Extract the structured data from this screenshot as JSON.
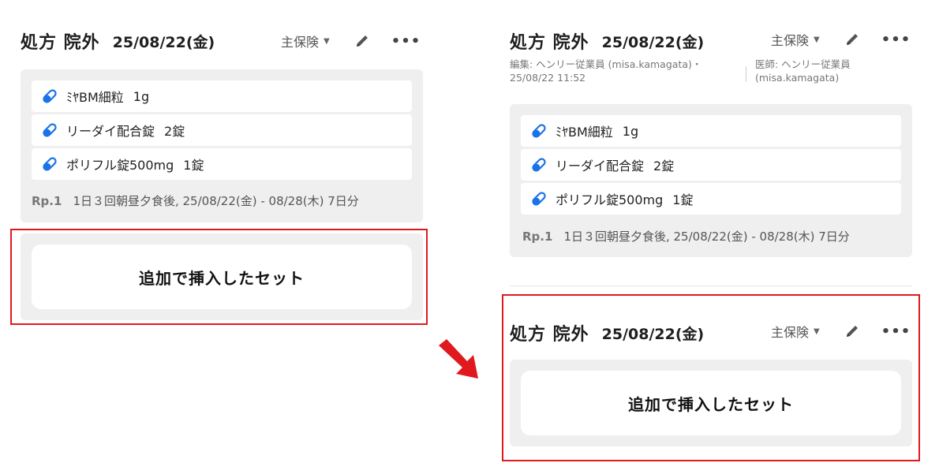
{
  "left_panel": {
    "title": "処方 院外",
    "date": "25/08/22(金)",
    "insurance": "主保険",
    "meds": [
      {
        "name": "ﾐﾔBM細粒",
        "qty": "1g"
      },
      {
        "name": "リーダイ配合錠",
        "qty": "2錠"
      },
      {
        "name": "ポリフル錠500mg",
        "qty": "1錠"
      }
    ],
    "rp_label": "Rp.1",
    "rp_text": "1日３回朝昼夕食後, 25/08/22(金) - 08/28(木) 7日分",
    "set_label": "追加で挿入したセット"
  },
  "right_panel": {
    "top_header": {
      "title": "処方 院外",
      "date": "25/08/22(金)",
      "insurance": "主保険"
    },
    "meta_editor": "編集: ヘンリー従業員 (misa.kamagata)・",
    "meta_time": "25/08/22 11:52",
    "meta_doctor": "医師: ヘンリー従業員",
    "meta_doctor_id": "(misa.kamagata)",
    "meds": [
      {
        "name": "ﾐﾔBM細粒",
        "qty": "1g"
      },
      {
        "name": "リーダイ配合錠",
        "qty": "2錠"
      },
      {
        "name": "ポリフル錠500mg",
        "qty": "1錠"
      }
    ],
    "rp_label": "Rp.1",
    "rp_text": "1日３回朝昼夕食後, 25/08/22(金) - 08/28(木) 7日分",
    "second_header": {
      "title": "処方 院外",
      "date": "25/08/22(金)",
      "insurance": "主保険"
    },
    "set_label": "追加で挿入したセット"
  },
  "icons": {
    "pill": "pill-icon",
    "pencil": "pencil-icon",
    "more": "more-icon",
    "caret": "chevron-down-icon",
    "arrow": "arrow-icon"
  },
  "colors": {
    "highlight": "#e0191e",
    "pill_blue": "#1a73e8",
    "card_bg": "#efefef"
  }
}
